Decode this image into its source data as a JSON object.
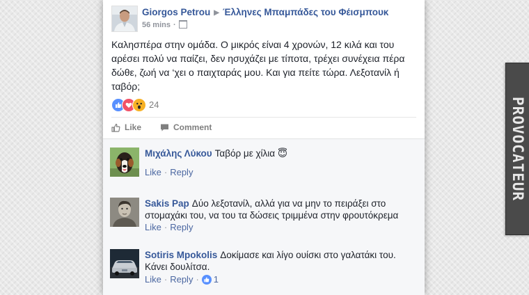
{
  "post": {
    "author": "Giorgos Petrou",
    "group": "Έλληνες Μπαμπάδες του Φέισμπουκ",
    "time": "56 mins",
    "text": "Καλησπέρα στην ομάδα. Ο μικρός είναι 4 χρονών, 12 κιλά και του αρέσει πολύ να παίζει, δεν ησυχάζει με τίποτα, τρέχει συνέχεια πέρα δώθε, ζωή να ‘χει ο παιχταράς μου. Και για πείτε τώρα. Λεξοτανίλ ή ταβόρ;",
    "reaction_count": "24",
    "like_label": "Like",
    "comment_label": "Comment"
  },
  "comments": [
    {
      "name": "Μιχάλης Λύκου",
      "text": "Ταβόρ με χίλια",
      "emoji": "😇",
      "like": "Like",
      "reply": "Reply"
    },
    {
      "name": "Sakis Pap",
      "text": "Δύο λεξοτανίλ, αλλά για να μην το πειράξει στο στομαχάκι του, να του τα δώσεις τριμμένα στην φρουτόκρεμα",
      "like": "Like",
      "reply": "Reply"
    },
    {
      "name": "Sotiris Mpokolis",
      "text": "Δοκίμασε και λίγο ουίσκι στο γαλατάκι του. Κάνει δουλίτσα.",
      "like": "Like",
      "reply": "Reply",
      "like_count": "1"
    }
  ],
  "watermark": "PROVOCATEUR",
  "colors": {
    "link_blue": "#365899",
    "text": "#1d2129",
    "muted": "#90949c",
    "like_blue": "#5890ff",
    "love_red": "#f25268",
    "wow_yellow": "#f7b125"
  },
  "icons": [
    "privacy-icon",
    "like-icon",
    "comment-icon",
    "like-reaction-icon",
    "love-reaction-icon",
    "wow-reaction-icon",
    "halo-emoji-icon"
  ]
}
